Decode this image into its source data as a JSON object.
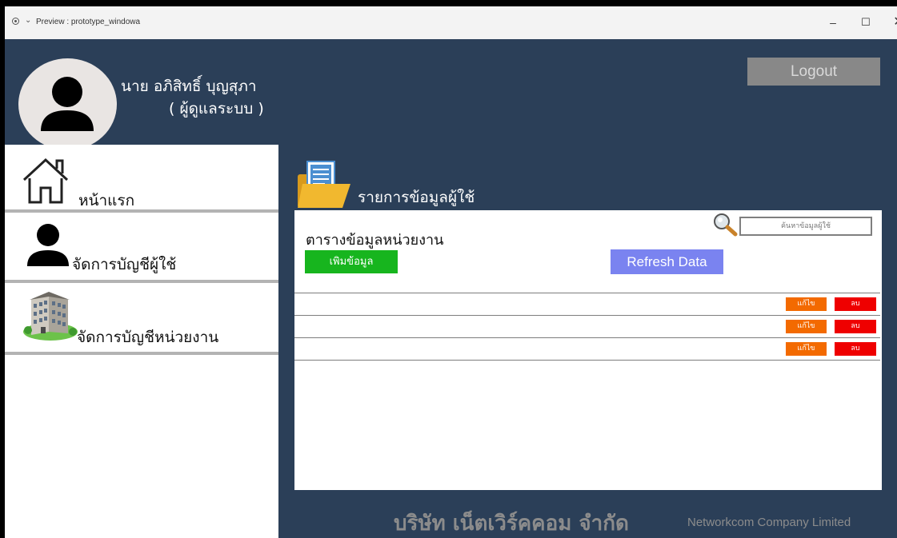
{
  "window": {
    "title": "Preview : prototype_windowa",
    "minimize": "–",
    "maximize": "☐",
    "close": "✕"
  },
  "header": {
    "user_name": "นาย อภิสิทธิ์ บุญสุภา",
    "user_role": "( ผู้ดูแลระบบ )",
    "logout_label": "Logout"
  },
  "sidebar": {
    "items": [
      {
        "label": "หน้าแรก",
        "icon": "home-icon"
      },
      {
        "label": "จัดการบัญชีผู้ใช้",
        "icon": "user-icon"
      },
      {
        "label": "จัดการบัญชีหน่วยงาน",
        "icon": "building-icon"
      }
    ]
  },
  "main": {
    "title": "รายการข้อมูลผู้ใช้",
    "title_icon": "folder-document-icon",
    "panel": {
      "title": "ตารางข้อมูลหน่วยงาน",
      "search_placeholder": "ค้นหาข้อมูลผู้ใช้",
      "add_label": "เพิมข้อมูล",
      "refresh_label": "Refresh Data",
      "rows": [
        {
          "edit_label": "แก้ไข",
          "delete_label": "ลบ"
        },
        {
          "edit_label": "แก้ไข",
          "delete_label": "ลบ"
        },
        {
          "edit_label": "แก้ไข",
          "delete_label": "ลบ"
        }
      ]
    }
  },
  "footer": {
    "company_th": "บริษัท เน็ตเวิร์คคอม จำกัด",
    "company_en": "Networkcom Company Limited"
  },
  "colors": {
    "app_bg": "#2b3f58",
    "logout_bg": "#888888",
    "add_bg": "#17b51e",
    "refresh_bg": "#7a83f0",
    "edit_bg": "#f36a00",
    "delete_bg": "#ef0000"
  }
}
